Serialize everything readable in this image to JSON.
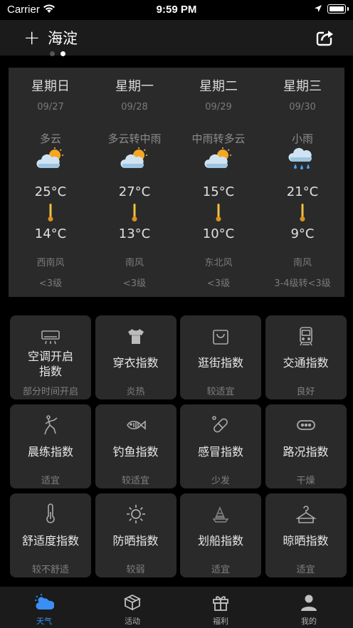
{
  "status_bar": {
    "carrier": "Carrier",
    "time": "9:59 PM"
  },
  "nav": {
    "add_label": "+",
    "city": "海淀",
    "page_count": 2,
    "active_page": 2
  },
  "forecast": [
    {
      "day": "星期日",
      "date": "09/27",
      "condition": "多云",
      "icon": "cloud-sun-icon",
      "high": "25°C",
      "low": "14°C",
      "wind": "西南风",
      "level": "<3级"
    },
    {
      "day": "星期一",
      "date": "09/28",
      "condition": "多云转中雨",
      "icon": "cloud-sun-icon",
      "high": "27°C",
      "low": "13°C",
      "wind": "南风",
      "level": "<3级"
    },
    {
      "day": "星期二",
      "date": "09/29",
      "condition": "中雨转多云",
      "icon": "cloud-sun-icon",
      "high": "15°C",
      "low": "10°C",
      "wind": "东北风",
      "level": "<3级"
    },
    {
      "day": "星期三",
      "date": "09/30",
      "condition": "小雨",
      "icon": "cloud-rain-icon",
      "high": "21°C",
      "low": "9°C",
      "wind": "南风",
      "level": "3-4级转<3级"
    }
  ],
  "indices": [
    {
      "title": "空调开启\n指数",
      "value": "部分时间开启",
      "icon": "air-conditioner-icon"
    },
    {
      "title": "穿衣指数",
      "value": "炎热",
      "icon": "tshirt-icon"
    },
    {
      "title": "逛街指数",
      "value": "较适宜",
      "icon": "shopping-bag-icon"
    },
    {
      "title": "交通指数",
      "value": "良好",
      "icon": "bus-icon"
    },
    {
      "title": "晨练指数",
      "value": "适宜",
      "icon": "exercise-icon"
    },
    {
      "title": "钓鱼指数",
      "value": "较适宜",
      "icon": "fish-icon"
    },
    {
      "title": "感冒指数",
      "value": "少发",
      "icon": "pill-icon"
    },
    {
      "title": "路况指数",
      "value": "干燥",
      "icon": "road-icon"
    },
    {
      "title": "舒适度指数",
      "value": "较不舒适",
      "icon": "thermometer-icon"
    },
    {
      "title": "防晒指数",
      "value": "较弱",
      "icon": "sun-icon"
    },
    {
      "title": "划船指数",
      "value": "适宜",
      "icon": "boat-icon"
    },
    {
      "title": "晾晒指数",
      "value": "适宜",
      "icon": "hanger-icon"
    }
  ],
  "tabs": [
    {
      "label": "天气",
      "icon": "weather-tab-icon",
      "active": true
    },
    {
      "label": "活动",
      "icon": "box-tab-icon",
      "active": false
    },
    {
      "label": "福利",
      "icon": "gift-tab-icon",
      "active": false
    },
    {
      "label": "我的",
      "icon": "profile-tab-icon",
      "active": false
    }
  ],
  "colors": {
    "accent": "#3a8ff5",
    "card": "#2a2a2a",
    "background": "#000000",
    "bar": "#1b1b1b"
  }
}
